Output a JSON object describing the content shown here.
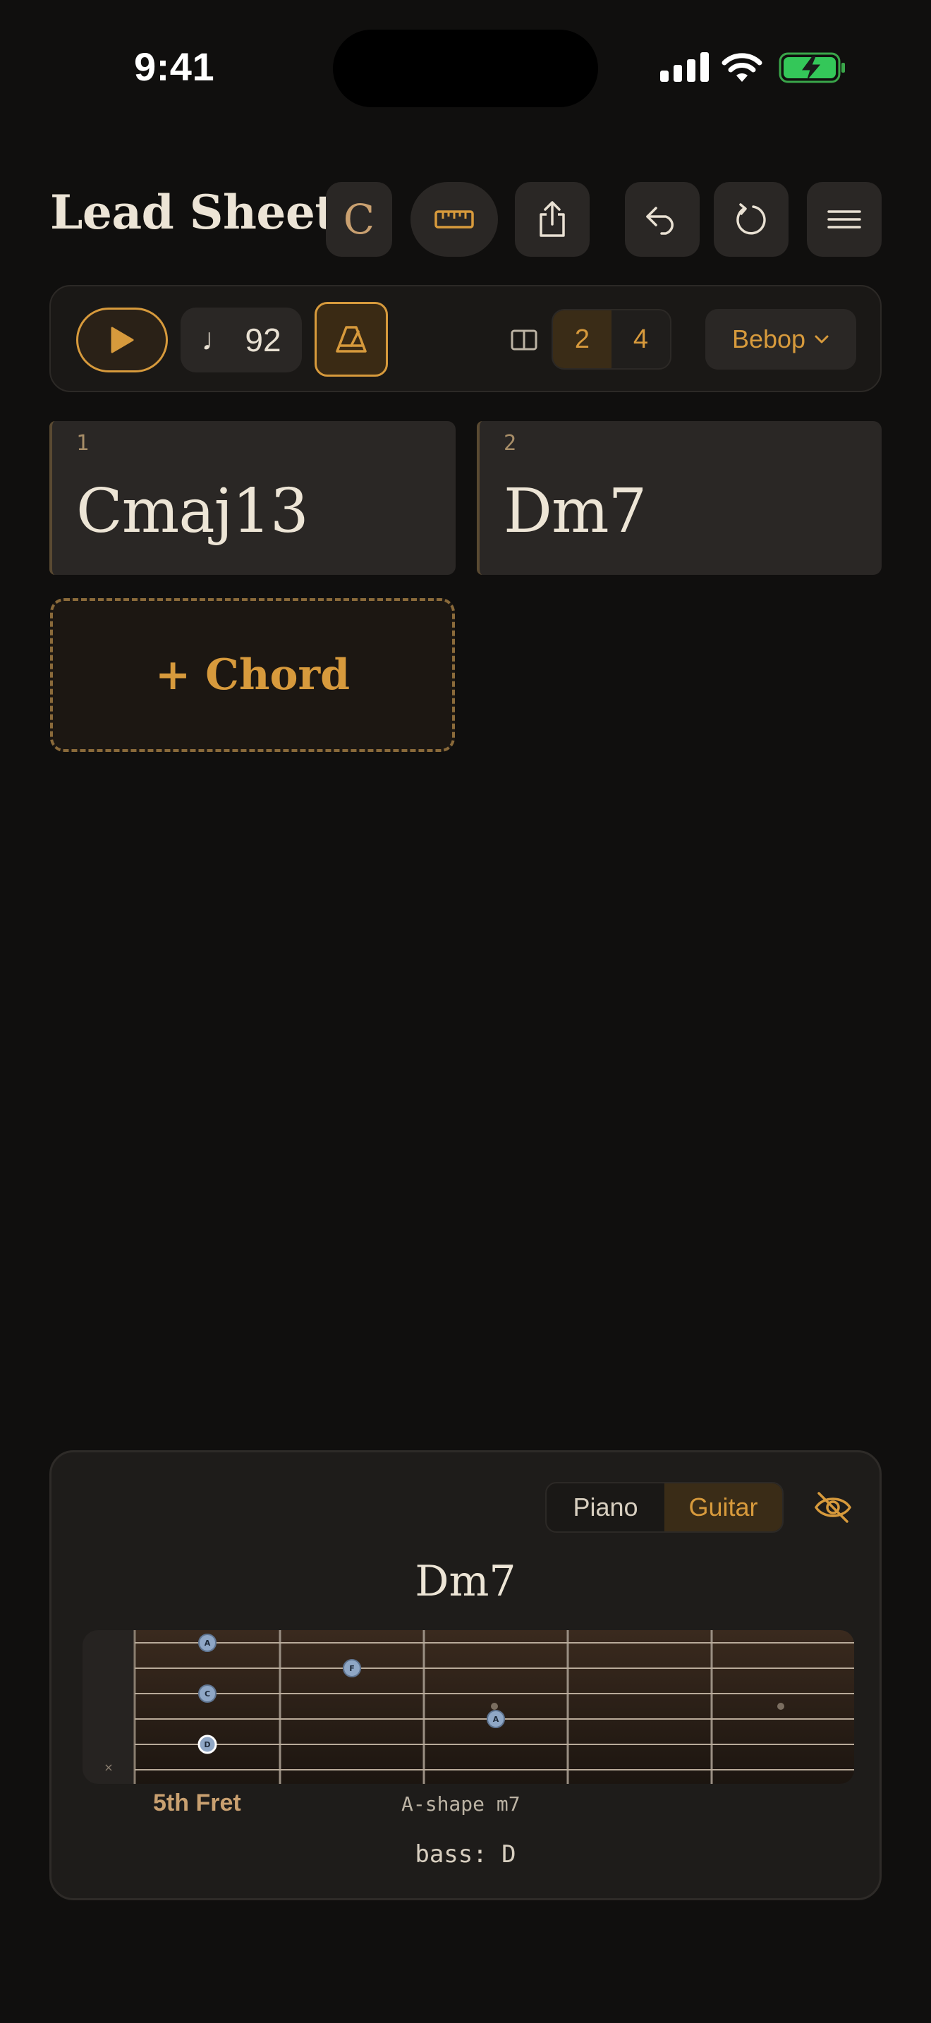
{
  "status_bar": {
    "time": "9:41"
  },
  "header": {
    "title": "Lead Sheet",
    "key": "C",
    "icons": [
      "ruler-icon",
      "share-icon",
      "undo-icon",
      "redo-icon",
      "menu-icon"
    ]
  },
  "transport": {
    "tempo_symbol": "♩",
    "tempo": "92",
    "bars_options": [
      "2",
      "4"
    ],
    "bars_selected": "2",
    "style": "Bebop",
    "icons": [
      "play-icon",
      "metronome-icon",
      "layout-icon",
      "chevron-down-icon"
    ]
  },
  "chords": [
    {
      "number": "1",
      "name": "Cmaj13"
    },
    {
      "number": "2",
      "name": "Dm7"
    }
  ],
  "add_chord": {
    "label": "+ Chord"
  },
  "instrument_panel": {
    "tabs": [
      "Piano",
      "Guitar"
    ],
    "selected_tab": "Guitar",
    "chord": "Dm7",
    "fret_position": "5th Fret",
    "shape": "A-shape m7",
    "bass": "bass: D",
    "muted_marker": "×",
    "notes": [
      {
        "string": 1,
        "fret": 5,
        "name": "A"
      },
      {
        "string": 2,
        "fret": 6,
        "name": "F"
      },
      {
        "string": 3,
        "fret": 5,
        "name": "C"
      },
      {
        "string": 4,
        "fret": 7,
        "name": "A"
      },
      {
        "string": 5,
        "fret": 5,
        "name": "D",
        "root": true
      }
    ]
  },
  "colors": {
    "background": "#100f0e",
    "accent": "#d79a3c",
    "card": "#2a2725",
    "text": "#ede5d6"
  }
}
